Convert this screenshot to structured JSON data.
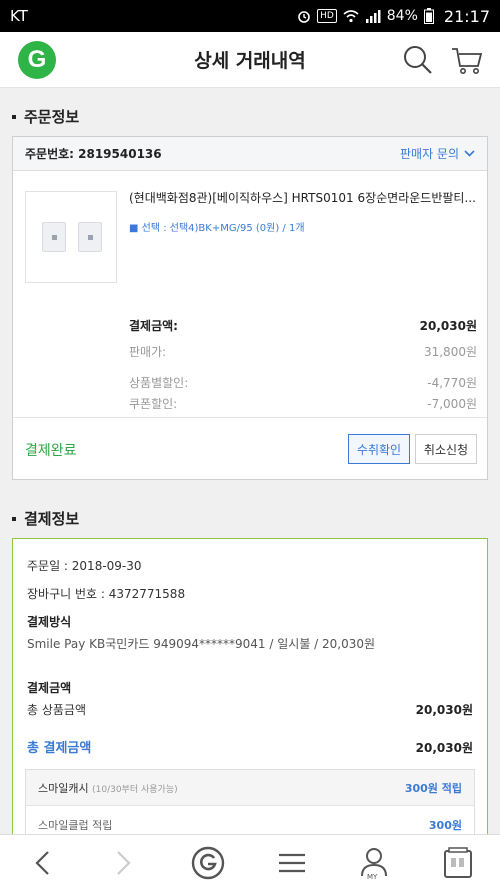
{
  "status_bar": {
    "carrier": "KT",
    "battery": "84%",
    "time": "21:17",
    "hd": "HD"
  },
  "header": {
    "logo_letter": "G",
    "title": "상세 거래내역"
  },
  "order_section": {
    "title": "주문정보",
    "order_number": "주문번호: 2819540136",
    "seller_inquiry": "판매자 문의",
    "product_name": "(현대백화점8관)[베이직하우스] HRTS0101 6장순면라운드반팔티...",
    "option": "선택 : 선택4)BK+MG/95 (0원) / 1개",
    "rows": [
      {
        "label": "결제금액:",
        "value": "20,030원"
      },
      {
        "label": "판매가:",
        "value": "31,800원"
      },
      {
        "label": "상품별할인:",
        "value": "-4,770원"
      },
      {
        "label": "쿠폰할인:",
        "value": "-7,000원"
      }
    ],
    "status": "결제완료",
    "confirm_button": "수취확인",
    "cancel_button": "취소신청"
  },
  "payment_section": {
    "title": "결제정보",
    "order_date": "주문일 : 2018-09-30",
    "cart_number": "장바구니 번호 : 4372771588",
    "method_label": "결제방식",
    "method_value": "Smile Pay KB국민카드 949094******9041 / 일시불 / 20,030원",
    "amount_label": "결제금액",
    "total_product_label": "총 상품금액",
    "total_product_value": "20,030원",
    "total_payment_label": "총 결제금액",
    "total_payment_value": "20,030원",
    "smile_cash_label": "스마일캐시",
    "smile_cash_note": "(10/30부터 사용가능)",
    "smile_cash_value": "300원 적립",
    "smile_club_label": "스마일클럽 적립",
    "smile_club_value": "300원"
  },
  "bottom_nav": {
    "my_label": "MY"
  },
  "colors": {
    "brand_green": "#2fb447",
    "link_blue": "#3a7ad5",
    "status_green": "#2fa644",
    "card_border_green": "#8ec63f"
  }
}
